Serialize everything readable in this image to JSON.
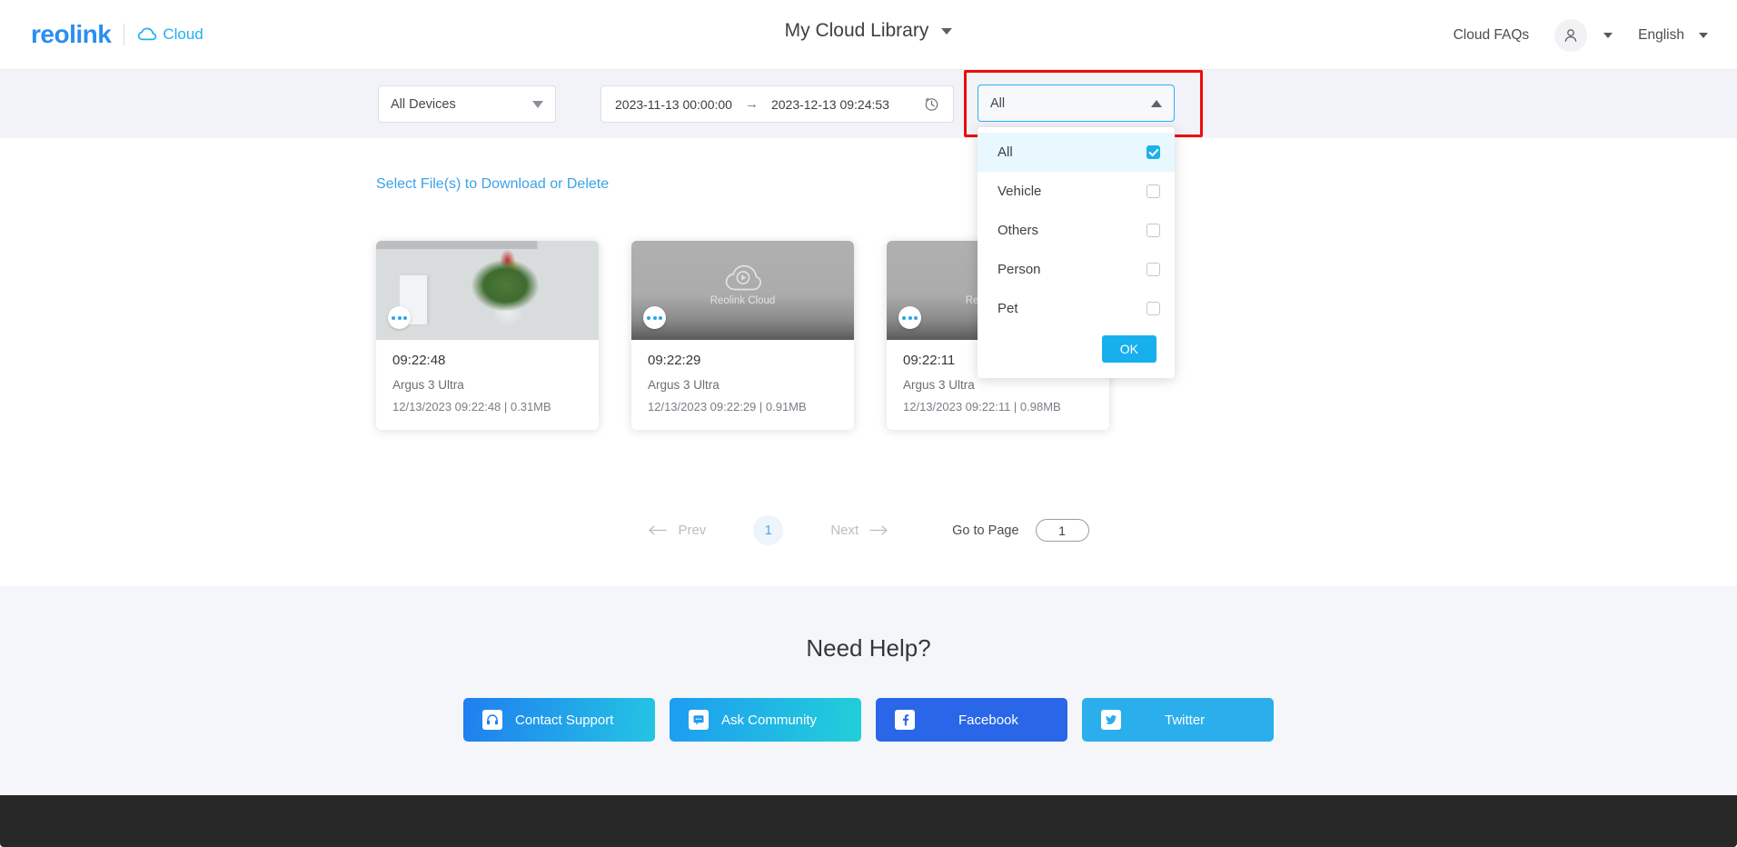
{
  "header": {
    "brand_name": "reolink",
    "brand_product": "Cloud",
    "title": "My Cloud Library",
    "faq_link": "Cloud FAQs",
    "language": "English"
  },
  "filter_bar": {
    "device_select": {
      "value": "All Devices"
    },
    "date_range": {
      "start": "2023-11-13  00:00:00",
      "arrow": "→",
      "end": "2023-12-13  09:24:53"
    },
    "type_select": {
      "value": "All",
      "expanded": true,
      "highlight_color": "#f00b0b",
      "border_color": "#2bb3ef",
      "options": [
        {
          "label": "All",
          "checked": true,
          "highlighted": true
        },
        {
          "label": "Vehicle",
          "checked": false,
          "highlighted": false
        },
        {
          "label": "Others",
          "checked": false,
          "highlighted": false
        },
        {
          "label": "Person",
          "checked": false,
          "highlighted": false
        },
        {
          "label": "Pet",
          "checked": false,
          "highlighted": false
        }
      ],
      "ok_label": "OK",
      "ok_color": "#18b0ec"
    }
  },
  "main": {
    "select_link": "Select File(s) to Download or Delete",
    "placeholder_label": "Reolink Cloud",
    "cards": [
      {
        "time": "09:22:48",
        "device": "Argus 3 Ultra",
        "meta": "12/13/2023 09:22:48 | 0.31MB",
        "has_photo": true
      },
      {
        "time": "09:22:29",
        "device": "Argus 3 Ultra",
        "meta": "12/13/2023 09:22:29 | 0.91MB",
        "has_photo": false
      },
      {
        "time": "09:22:11",
        "device": "Argus 3 Ultra",
        "meta": "12/13/2023 09:22:11 | 0.98MB",
        "has_photo": false
      }
    ]
  },
  "pagination": {
    "prev_label": "Prev",
    "next_label": "Next",
    "current_page": "1",
    "goto_label": "Go to Page",
    "goto_value": "1"
  },
  "help": {
    "title": "Need Help?",
    "buttons": [
      {
        "label": "Contact Support",
        "icon": "headset-icon"
      },
      {
        "label": "Ask Community",
        "icon": "chat-icon"
      },
      {
        "label": "Facebook",
        "icon": "facebook-icon"
      },
      {
        "label": "Twitter",
        "icon": "twitter-icon"
      }
    ]
  }
}
